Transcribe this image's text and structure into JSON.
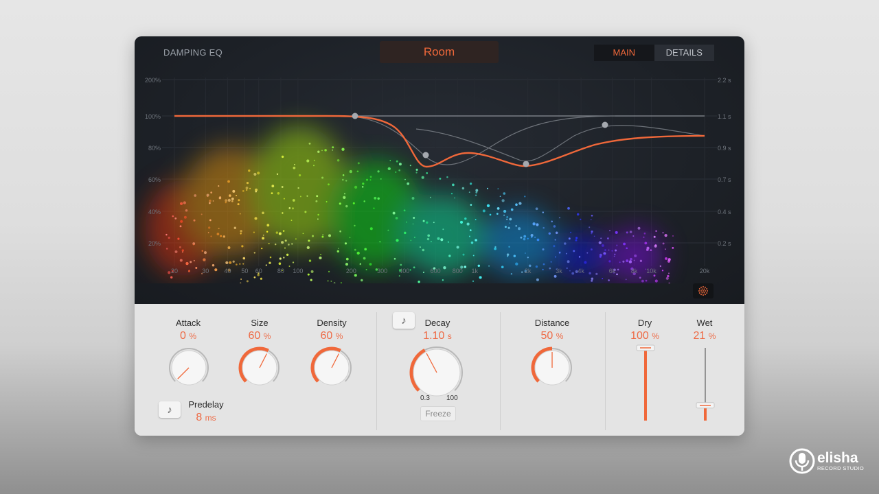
{
  "header": {
    "section_title": "DAMPING EQ",
    "preset_name": "Room",
    "tabs": [
      {
        "label": "MAIN",
        "active": true
      },
      {
        "label": "DETAILS",
        "active": false
      }
    ]
  },
  "graph": {
    "left_axis": [
      "200%",
      "100%",
      "80%",
      "60%",
      "40%",
      "20%"
    ],
    "right_axis": [
      "2.2 s",
      "1.1 s",
      "0.9 s",
      "0.7 s",
      "0.4 s",
      "0.2 s"
    ],
    "freq_axis": [
      "20",
      "30",
      "40",
      "50",
      "60",
      "80",
      "100",
      "200",
      "300",
      "400",
      "600",
      "800",
      "1k",
      "2k",
      "3k",
      "4k",
      "6k",
      "8k",
      "10k",
      "20k"
    ],
    "accent_color": "#f0683a",
    "display_toggle_icon": "particles-icon"
  },
  "controls": {
    "attack": {
      "label": "Attack",
      "value": "0",
      "unit": "%",
      "level": 0
    },
    "size": {
      "label": "Size",
      "value": "60",
      "unit": "%",
      "level": 0.6
    },
    "density": {
      "label": "Density",
      "value": "60",
      "unit": "%",
      "level": 0.6
    },
    "predelay": {
      "label": "Predelay",
      "value": "8",
      "unit": "ms"
    },
    "decay": {
      "label": "Decay",
      "value": "1.10",
      "unit": "s",
      "range_min": "0.3",
      "range_max": "100",
      "freeze_label": "Freeze"
    },
    "distance": {
      "label": "Distance",
      "value": "50",
      "unit": "%",
      "level": 0.5
    },
    "dry": {
      "label": "Dry",
      "value": "100",
      "unit": "%",
      "level": 1.0
    },
    "wet": {
      "label": "Wet",
      "value": "21",
      "unit": "%",
      "level": 0.21
    }
  },
  "watermark": {
    "name": "elisha",
    "subtitle": "RECORD STUDIO"
  }
}
